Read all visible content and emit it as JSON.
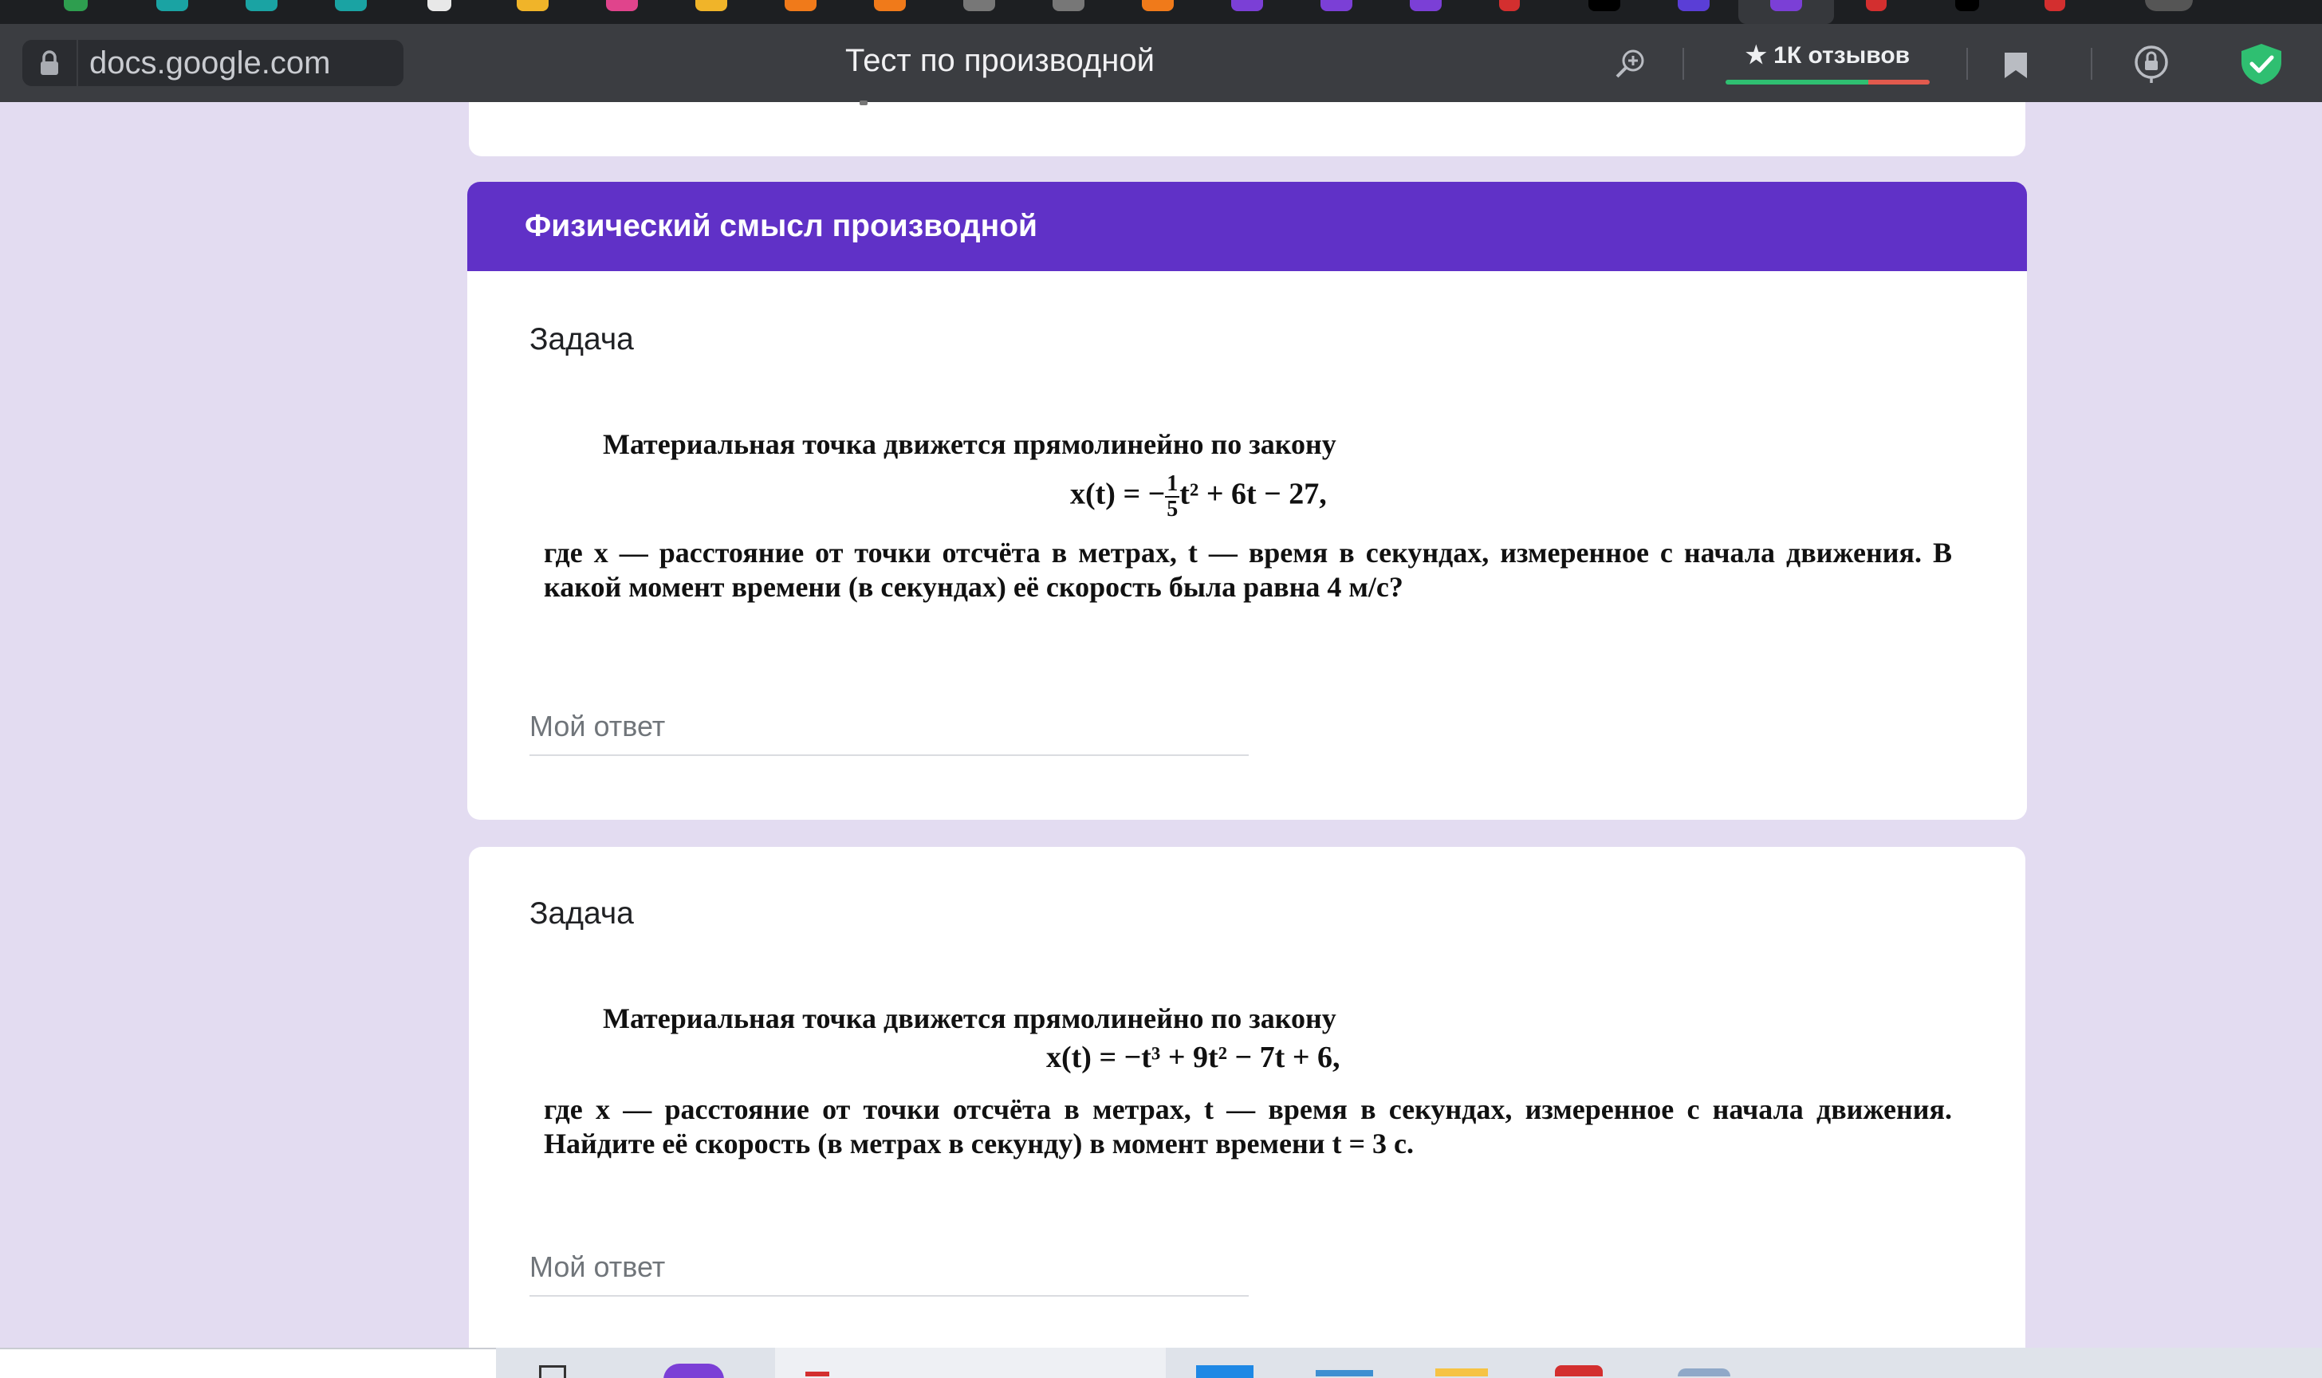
{
  "browser": {
    "url": "docs.google.com",
    "page_title": "Тест по производной",
    "reviews_label": "1К отзывов"
  },
  "section": {
    "title": "Физический смысл производной"
  },
  "questions": [
    {
      "label": "Задача",
      "intro": "Материальная точка движется прямолинейно по закону",
      "formula_lhs": "x(t) = −",
      "formula_frac_num": "1",
      "formula_frac_den": "5",
      "formula_rhs": "t² + 6t − 27,",
      "body": "где x — расстояние от точки отсчёта в метрах, t — время в секундах, измерен­ное с начала движения. В какой момент времени (в секундах) её скорость бы­ла равна 4 м/с?",
      "answer_placeholder": "Мой ответ"
    },
    {
      "label": "Задача",
      "intro": "Материальная точка движется прямолинейно по закону",
      "formula": "x(t) = −t³ + 9t² − 7t + 6,",
      "body": "где x — расстояние от точки отсчёта в метрах, t — время в секундах, измерен­ное с начала движения. Найдите её скорость (в метрах в секунду) в момент времени t = 3 с.",
      "answer_placeholder": "Мой ответ"
    }
  ],
  "colors": {
    "page_bg": "#e3dcf1",
    "section_header": "#6031c7",
    "toolbar": "#3b3d41",
    "shield": "#2fbf71"
  },
  "icons": [
    "lock-icon",
    "search-zoom-icon",
    "star-icon",
    "bookmark-icon",
    "extension-icon",
    "shield-check-icon"
  ]
}
